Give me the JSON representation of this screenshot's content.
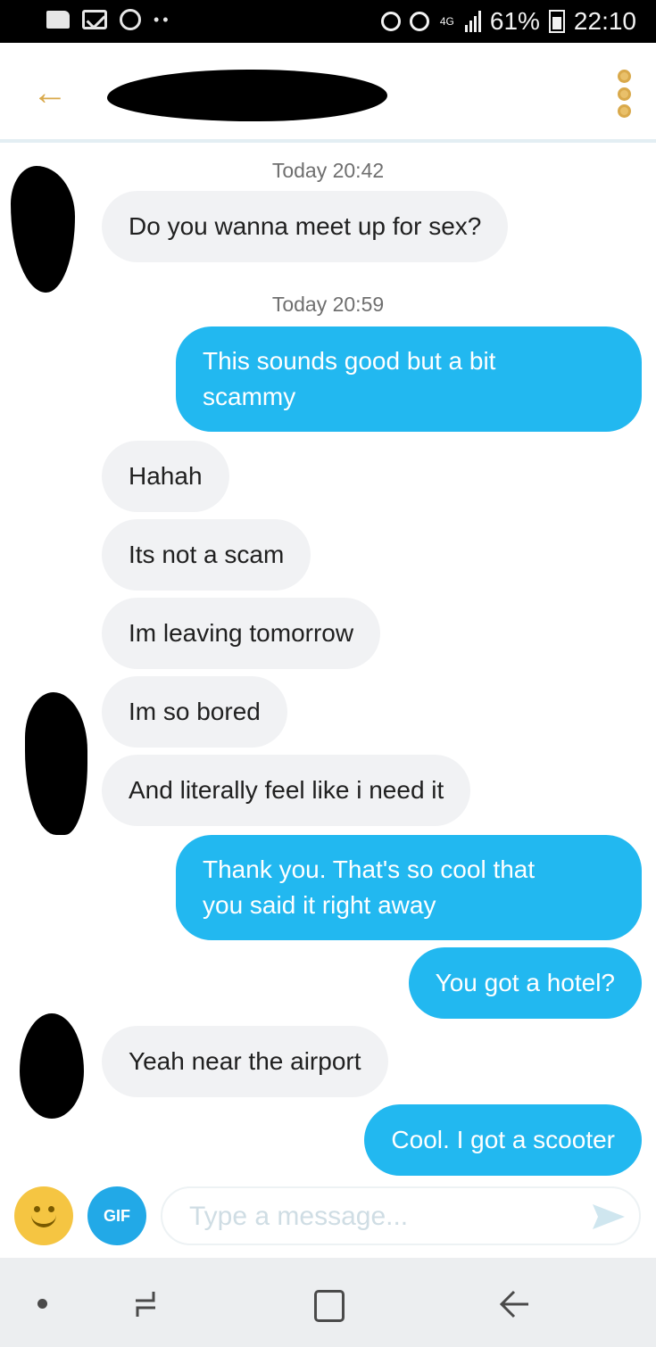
{
  "status_bar": {
    "battery_percent": "61%",
    "time": "22:10",
    "network": "4G"
  },
  "header": {
    "back_icon": "arrow-left-icon",
    "menu_icon": "vertical-dots-icon",
    "accent_color": "#d9a94b"
  },
  "chat": {
    "timestamps": [
      "Today 20:42",
      "Today 20:59"
    ],
    "messages": [
      {
        "from": "them",
        "text": "Do you wanna meet up for sex?"
      },
      {
        "from": "me",
        "lines": [
          "This sounds good but a bit",
          "scammy"
        ]
      },
      {
        "from": "them",
        "text": "Hahah"
      },
      {
        "from": "them",
        "text": "Its not a scam"
      },
      {
        "from": "them",
        "text": "Im leaving tomorrow"
      },
      {
        "from": "them",
        "text": "Im so bored"
      },
      {
        "from": "them",
        "text": "And literally feel like i need it"
      },
      {
        "from": "me",
        "lines": [
          "Thank you. That's so cool that",
          "you said it right away"
        ]
      },
      {
        "from": "me",
        "text": "You got a hotel?"
      },
      {
        "from": "them",
        "text": "Yeah near the airport"
      },
      {
        "from": "me",
        "text": "Cool. I got a scooter"
      }
    ],
    "outgoing_color": "#22b8f0",
    "incoming_color": "#f1f2f4"
  },
  "composer": {
    "gif_label": "GIF",
    "placeholder": "Type a message...",
    "emoji_icon": "smiley-icon",
    "send_icon": "send-icon"
  },
  "nav_bar": {
    "icons": [
      "dot-icon",
      "recent-apps-icon",
      "home-icon",
      "back-icon"
    ]
  }
}
